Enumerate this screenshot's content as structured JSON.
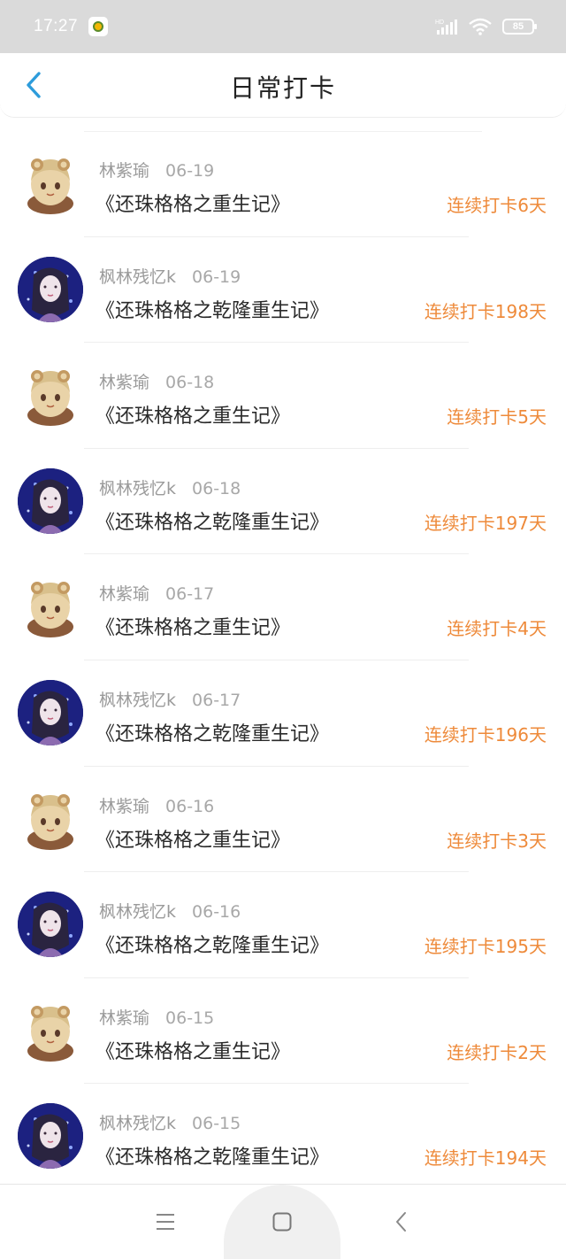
{
  "status_bar": {
    "time": "17:27",
    "battery_level": "85",
    "icons": [
      "app-notification-icon",
      "hd-signal-icon",
      "wifi-icon",
      "battery-icon"
    ]
  },
  "header": {
    "title": "日常打卡",
    "back_icon": "chevron-left-icon",
    "accent_color": "#2d9cdb"
  },
  "checkins": [
    {
      "user": "林紫瑜",
      "date": "06-19",
      "title": "《还珠格格之重生记》",
      "streak": "连续打卡6天",
      "avatar": "avatar-cartoon"
    },
    {
      "user": "枫林残忆k",
      "date": "06-19",
      "title": "《还珠格格之乾隆重生记》",
      "streak": "连续打卡198天",
      "avatar": "avatar-photo"
    },
    {
      "user": "林紫瑜",
      "date": "06-18",
      "title": "《还珠格格之重生记》",
      "streak": "连续打卡5天",
      "avatar": "avatar-cartoon"
    },
    {
      "user": "枫林残忆k",
      "date": "06-18",
      "title": "《还珠格格之乾隆重生记》",
      "streak": "连续打卡197天",
      "avatar": "avatar-photo"
    },
    {
      "user": "林紫瑜",
      "date": "06-17",
      "title": "《还珠格格之重生记》",
      "streak": "连续打卡4天",
      "avatar": "avatar-cartoon"
    },
    {
      "user": "枫林残忆k",
      "date": "06-17",
      "title": "《还珠格格之乾隆重生记》",
      "streak": "连续打卡196天",
      "avatar": "avatar-photo"
    },
    {
      "user": "林紫瑜",
      "date": "06-16",
      "title": "《还珠格格之重生记》",
      "streak": "连续打卡3天",
      "avatar": "avatar-cartoon"
    },
    {
      "user": "枫林残忆k",
      "date": "06-16",
      "title": "《还珠格格之乾隆重生记》",
      "streak": "连续打卡195天",
      "avatar": "avatar-photo"
    },
    {
      "user": "林紫瑜",
      "date": "06-15",
      "title": "《还珠格格之重生记》",
      "streak": "连续打卡2天",
      "avatar": "avatar-cartoon"
    },
    {
      "user": "枫林残忆k",
      "date": "06-15",
      "title": "《还珠格格之乾隆重生记》",
      "streak": "连续打卡194天",
      "avatar": "avatar-photo"
    }
  ],
  "colors": {
    "streak": "#ee8a3a",
    "meta_text": "#9a9a9a",
    "title_text": "#2a2a2a"
  },
  "nav_bar": {
    "buttons": [
      "menu-icon",
      "home-icon",
      "back-icon"
    ]
  }
}
